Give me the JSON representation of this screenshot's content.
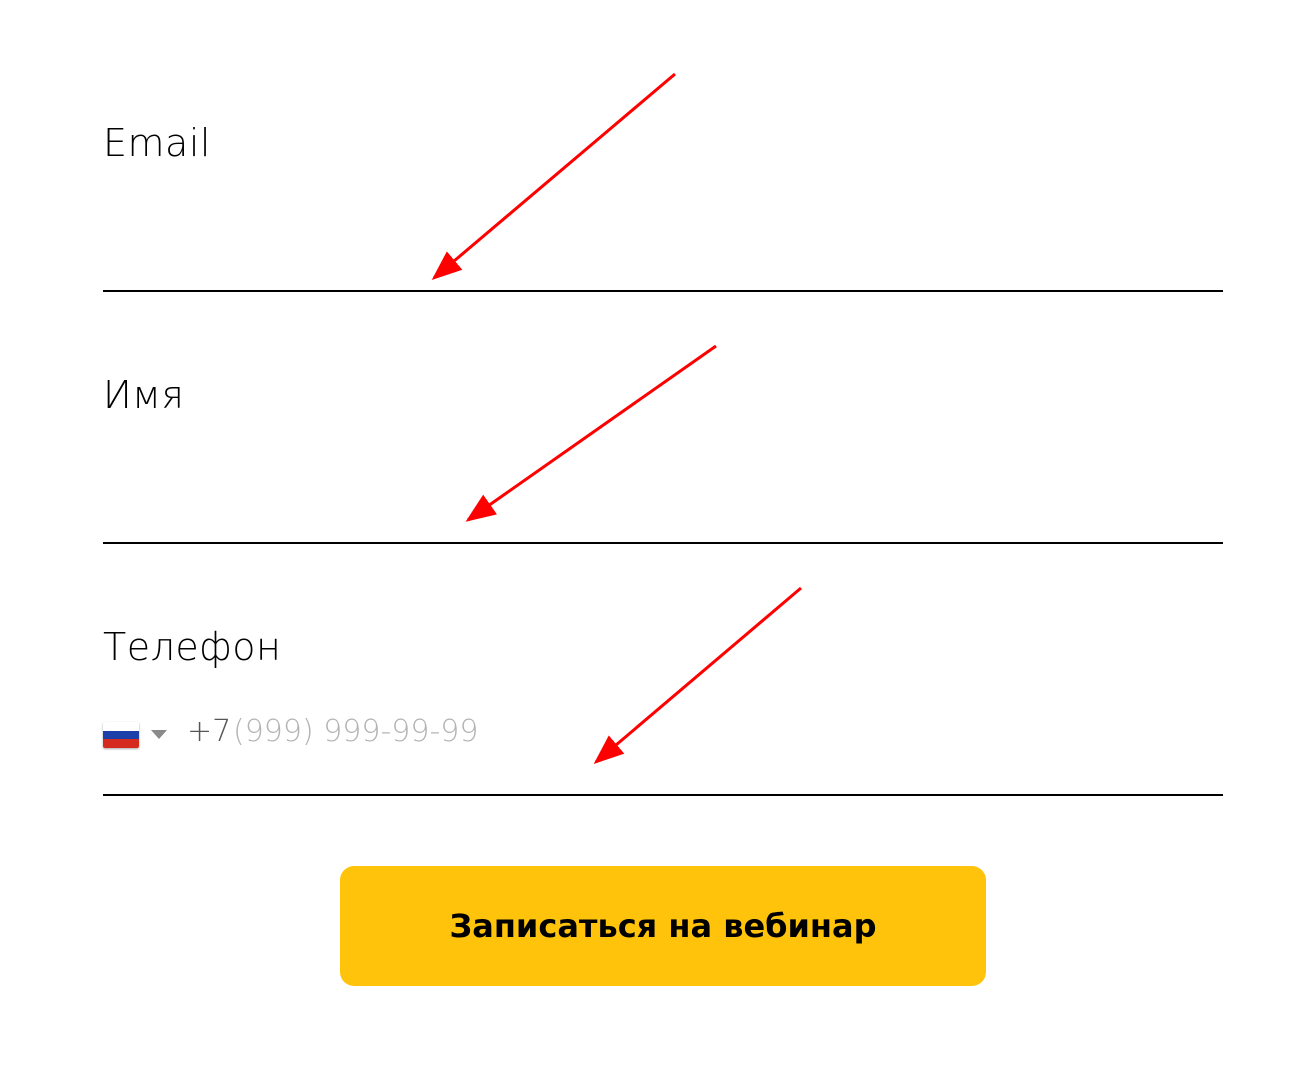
{
  "form": {
    "email": {
      "label": "Email",
      "value": "",
      "placeholder": ""
    },
    "name": {
      "label": "Имя",
      "value": "",
      "placeholder": ""
    },
    "phone": {
      "label": "Телефон",
      "country_flag": "russia-flag-icon",
      "dropdown_icon": "caret-down-icon",
      "code": "+7",
      "value": "",
      "placeholder": "(999) 999-99-99"
    },
    "submit_label": "Записаться на вебинар"
  },
  "colors": {
    "button_background": "#FFC30B",
    "button_text": "#000000",
    "field_underline": "#000000",
    "annotation_arrow": "#FF0000",
    "flag_white": "#FFFFFF",
    "flag_blue": "#1C3FAA",
    "flag_red": "#D52B1E"
  },
  "annotations": {
    "arrow_icon": "red-arrow-icon",
    "count": 3
  }
}
